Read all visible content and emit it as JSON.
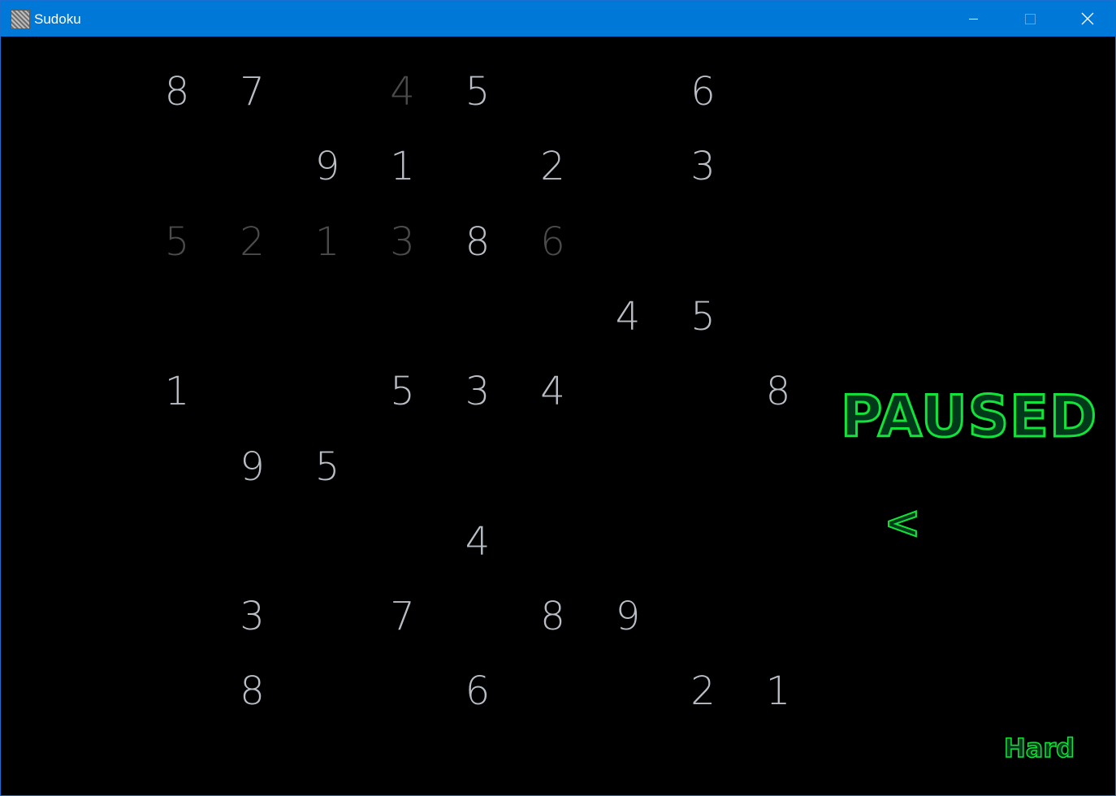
{
  "window": {
    "title": "Sudoku",
    "icon": "sudoku-app-icon",
    "controls": {
      "minimize": "minimize-icon",
      "maximize": "maximize-icon",
      "close": "close-icon"
    }
  },
  "board": {
    "rows": [
      [
        {
          "v": "8",
          "d": false
        },
        {
          "v": "7",
          "d": false
        },
        {
          "v": "",
          "d": false
        },
        {
          "v": "4",
          "d": true
        },
        {
          "v": "5",
          "d": false
        },
        {
          "v": "",
          "d": false
        },
        {
          "v": "",
          "d": false
        },
        {
          "v": "6",
          "d": false
        },
        {
          "v": "",
          "d": false
        }
      ],
      [
        {
          "v": "",
          "d": false
        },
        {
          "v": "",
          "d": false
        },
        {
          "v": "9",
          "d": false
        },
        {
          "v": "1",
          "d": false
        },
        {
          "v": "",
          "d": false
        },
        {
          "v": "2",
          "d": false
        },
        {
          "v": "",
          "d": false
        },
        {
          "v": "3",
          "d": false
        },
        {
          "v": "",
          "d": false
        }
      ],
      [
        {
          "v": "5",
          "d": true
        },
        {
          "v": "2",
          "d": true
        },
        {
          "v": "1",
          "d": true
        },
        {
          "v": "3",
          "d": true
        },
        {
          "v": "8",
          "d": false
        },
        {
          "v": "6",
          "d": true
        },
        {
          "v": "",
          "d": false
        },
        {
          "v": "",
          "d": false
        },
        {
          "v": "",
          "d": false
        }
      ],
      [
        {
          "v": "",
          "d": false
        },
        {
          "v": "",
          "d": false
        },
        {
          "v": "",
          "d": false
        },
        {
          "v": "",
          "d": false
        },
        {
          "v": "",
          "d": false
        },
        {
          "v": "",
          "d": false
        },
        {
          "v": "4",
          "d": false
        },
        {
          "v": "5",
          "d": false
        },
        {
          "v": "",
          "d": false
        }
      ],
      [
        {
          "v": "1",
          "d": false
        },
        {
          "v": "",
          "d": false
        },
        {
          "v": "",
          "d": false
        },
        {
          "v": "5",
          "d": false
        },
        {
          "v": "3",
          "d": false
        },
        {
          "v": "4",
          "d": false
        },
        {
          "v": "",
          "d": false
        },
        {
          "v": "",
          "d": false
        },
        {
          "v": "8",
          "d": false
        }
      ],
      [
        {
          "v": "",
          "d": false
        },
        {
          "v": "9",
          "d": false
        },
        {
          "v": "5",
          "d": false
        },
        {
          "v": "",
          "d": false
        },
        {
          "v": "",
          "d": false
        },
        {
          "v": "",
          "d": false
        },
        {
          "v": "",
          "d": false
        },
        {
          "v": "",
          "d": false
        },
        {
          "v": "",
          "d": false
        }
      ],
      [
        {
          "v": "",
          "d": false
        },
        {
          "v": "",
          "d": false
        },
        {
          "v": "",
          "d": false
        },
        {
          "v": "",
          "d": false
        },
        {
          "v": "4",
          "d": false
        },
        {
          "v": "",
          "d": false
        },
        {
          "v": "",
          "d": false
        },
        {
          "v": "",
          "d": false
        },
        {
          "v": "",
          "d": false
        }
      ],
      [
        {
          "v": "",
          "d": false
        },
        {
          "v": "3",
          "d": false
        },
        {
          "v": "",
          "d": false
        },
        {
          "v": "7",
          "d": false
        },
        {
          "v": "",
          "d": false
        },
        {
          "v": "8",
          "d": false
        },
        {
          "v": "9",
          "d": false
        },
        {
          "v": "",
          "d": false
        },
        {
          "v": "",
          "d": false
        }
      ],
      [
        {
          "v": "",
          "d": false
        },
        {
          "v": "8",
          "d": false
        },
        {
          "v": "",
          "d": false
        },
        {
          "v": "",
          "d": false
        },
        {
          "v": "6",
          "d": false
        },
        {
          "v": "",
          "d": false
        },
        {
          "v": "",
          "d": false
        },
        {
          "v": "2",
          "d": false
        },
        {
          "v": "1",
          "d": false
        }
      ]
    ]
  },
  "status": {
    "paused_label": "PAUSED",
    "back_label": "<",
    "difficulty_label": "Hard"
  },
  "colors": {
    "titlebar": "#0078d7",
    "background": "#000000",
    "digit": "#b9bec6",
    "digit_dim": "#4b4b4b",
    "accent_outline": "#13e23a",
    "accent_fill": "#003a1a"
  }
}
